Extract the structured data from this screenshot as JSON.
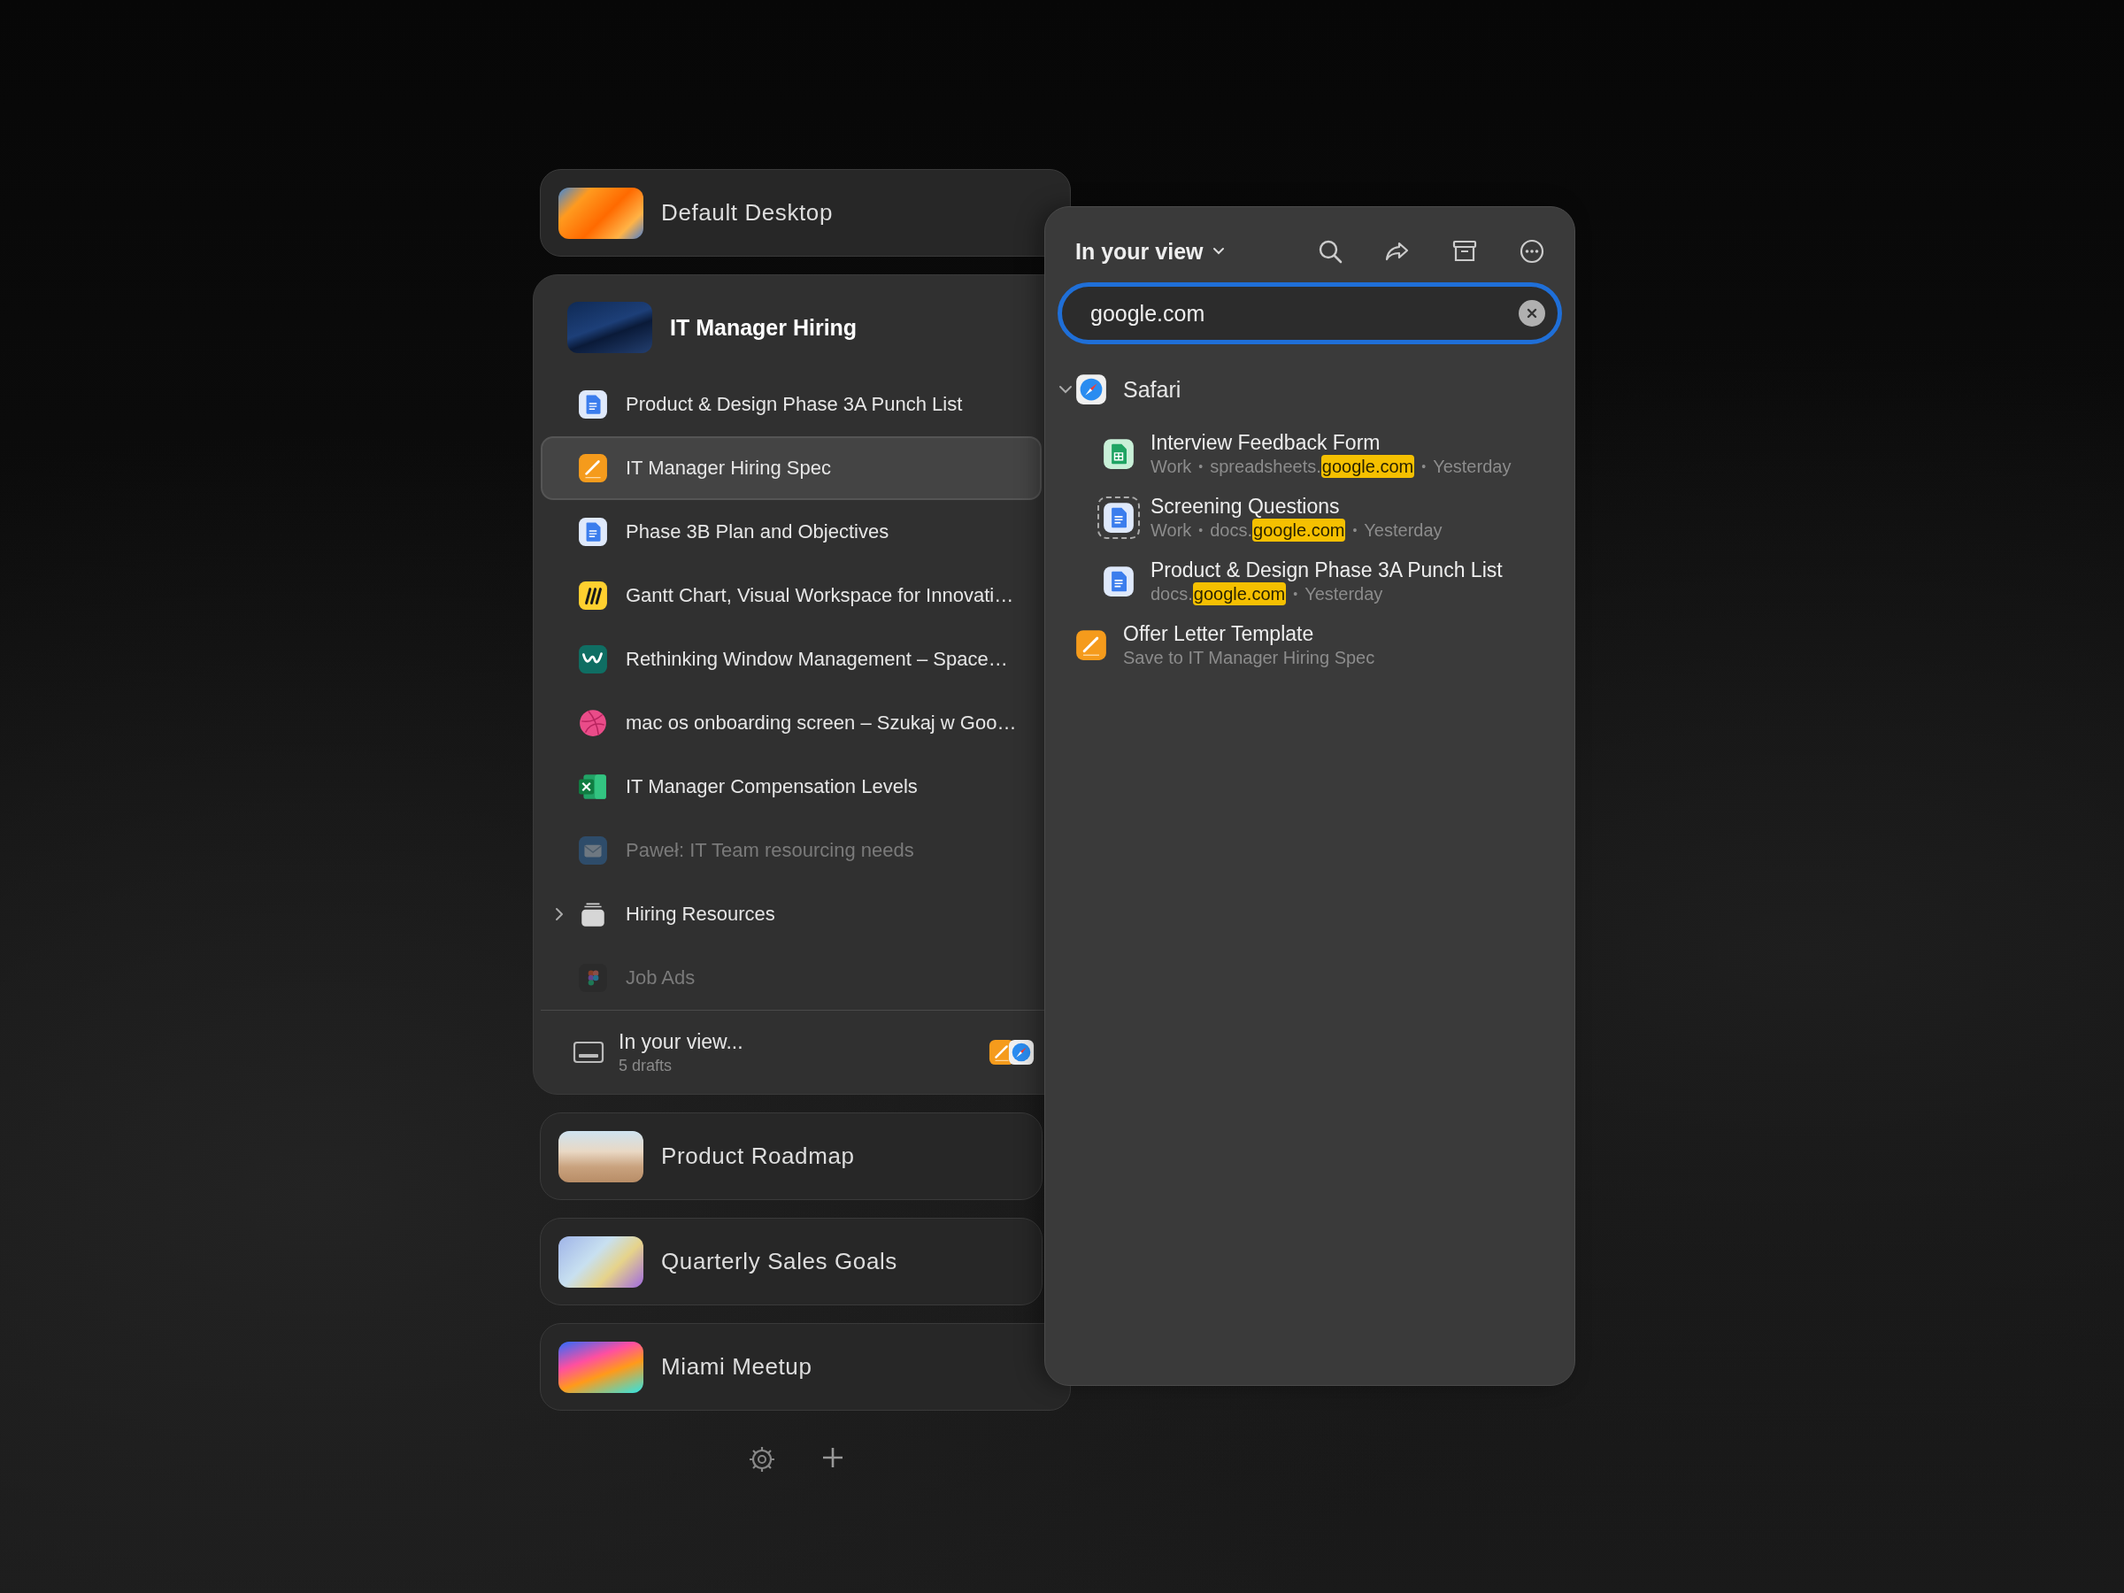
{
  "desktops": [
    {
      "name": "Default Desktop",
      "expanded": false
    },
    {
      "name": "IT Manager Hiring",
      "expanded": true,
      "items": [
        {
          "label": "Product & Design Phase 3A Punch List",
          "kind": "docs",
          "selected": false,
          "dimmed": false
        },
        {
          "label": "IT Manager Hiring Spec",
          "kind": "pages",
          "selected": true,
          "dimmed": false
        },
        {
          "label": "Phase 3B Plan and Objectives",
          "kind": "docs",
          "selected": false,
          "dimmed": false
        },
        {
          "label": "Gantt Chart, Visual Workspace for Innovati…",
          "kind": "miro",
          "selected": false,
          "dimmed": false
        },
        {
          "label": "Rethinking Window Management – Space…",
          "kind": "webflow",
          "selected": false,
          "dimmed": false
        },
        {
          "label": "mac os onboarding screen – Szukaj w Goo…",
          "kind": "dribbble",
          "selected": false,
          "dimmed": false
        },
        {
          "label": "IT Manager Compensation Levels",
          "kind": "excel",
          "selected": false,
          "dimmed": false
        },
        {
          "label": "Paweł: IT Team resourcing needs",
          "kind": "mail",
          "selected": false,
          "dimmed": true
        },
        {
          "label": "Hiring Resources",
          "kind": "folder",
          "selected": false,
          "dimmed": false,
          "expanded": false
        },
        {
          "label": "Job Ads",
          "kind": "figma",
          "selected": false,
          "dimmed": true
        }
      ],
      "footer": {
        "title": "In your view...",
        "subtitle": "5 drafts",
        "apps": [
          {
            "kind": "pages"
          },
          {
            "kind": "safari"
          }
        ]
      }
    },
    {
      "name": "Product Roadmap",
      "expanded": false
    },
    {
      "name": "Quarterly Sales Goals",
      "expanded": false
    },
    {
      "name": "Miami Meetup",
      "expanded": false
    }
  ],
  "panel": {
    "title": "In your view",
    "search": {
      "value": "google.com"
    },
    "separator": "•",
    "results": [
      {
        "kind": "safari",
        "label": "Safari",
        "expanded": true,
        "children": [
          {
            "title": "Interview Feedback Form",
            "kind": "sheets",
            "focused": false,
            "meta": [
              [
                {
                  "text": "Work",
                  "match": false
                }
              ],
              [
                {
                  "text": "spreadsheets.",
                  "match": false
                },
                {
                  "text": "google.com",
                  "match": true
                }
              ],
              [
                {
                  "text": "Yesterday",
                  "match": false
                }
              ]
            ]
          },
          {
            "title": "Screening Questions",
            "kind": "docs",
            "focused": true,
            "meta": [
              [
                {
                  "text": "Work",
                  "match": false
                }
              ],
              [
                {
                  "text": "docs.",
                  "match": false
                },
                {
                  "text": "google.com",
                  "match": true
                }
              ],
              [
                {
                  "text": "Yesterday",
                  "match": false
                }
              ]
            ]
          },
          {
            "title": "Product & Design Phase 3A Punch List",
            "kind": "docs",
            "focused": false,
            "meta": [
              [
                {
                  "text": "docs.",
                  "match": false
                },
                {
                  "text": "google.com",
                  "match": true
                }
              ],
              [
                {
                  "text": "Yesterday",
                  "match": false
                }
              ]
            ]
          }
        ]
      },
      {
        "kind": "pages",
        "title": "Offer Letter Template",
        "meta": [
          [
            {
              "text": "Save to IT Manager Hiring Spec",
              "match": false
            }
          ]
        ]
      }
    ]
  }
}
